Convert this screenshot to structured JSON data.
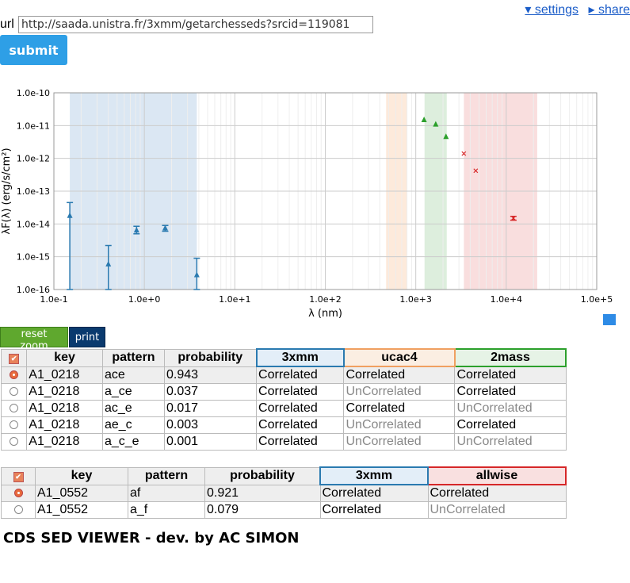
{
  "top_links": {
    "settings": "▾ settings",
    "share": "▸ share"
  },
  "url_label": "url",
  "url_value": "http://saada.unistra.fr/3xmm/getarchesseds?srcid=119081",
  "submit_label": "submit",
  "reset_zoom_label": "reset zoom",
  "print_label": "print",
  "footer": "CDS SED VIEWER - dev. by AC SIMON",
  "chart_data": {
    "type": "scatter",
    "xlabel": "λ (nm)",
    "ylabel": "λF(λ) (erg/s/cm²)",
    "xscale": "log",
    "yscale": "log",
    "xlim": [
      0.1,
      100000
    ],
    "ylim": [
      1e-16,
      1e-10
    ],
    "x_tick_labels": [
      "1.0e-1",
      "1.0e+0",
      "1.0e+1",
      "1.0e+2",
      "1.0e+3",
      "1.0e+4",
      "1.0e+5"
    ],
    "y_tick_labels": [
      "1.0e-10",
      "1.0e-11",
      "1.0e-12",
      "1.0e-13",
      "1.0e-14",
      "1.0e-15",
      "1.0e-16"
    ],
    "bands": [
      {
        "x0": 0.15,
        "x1": 3.8,
        "color": "#dbe7f3"
      },
      {
        "x0": 470,
        "x1": 800,
        "color": "#fdeadb"
      },
      {
        "x0": 1250,
        "x1": 2200,
        "color": "#ddeedd"
      },
      {
        "x0": 3400,
        "x1": 22000,
        "color": "#f9dede"
      }
    ],
    "series": [
      {
        "marker": "triangle",
        "color": "#2a7ab0",
        "points": [
          {
            "x": 0.15,
            "y": 1.8e-14,
            "ylo": 1e-16,
            "yhi": 4.5e-14
          },
          {
            "x": 0.4,
            "y": 6e-16,
            "ylo": 1e-16,
            "yhi": 2.2e-15
          },
          {
            "x": 0.82,
            "y": 6.5e-15,
            "ylo": 5e-15,
            "yhi": 8.5e-15
          },
          {
            "x": 1.7,
            "y": 7.5e-15,
            "ylo": 6e-15,
            "yhi": 9e-15
          },
          {
            "x": 3.8,
            "y": 2.8e-16,
            "ylo": 1e-16,
            "yhi": 9e-16
          }
        ]
      },
      {
        "marker": "triangle",
        "color": "#2ca02c",
        "points": [
          {
            "x": 1235,
            "y": 1.5e-11
          },
          {
            "x": 1662,
            "y": 1.1e-11
          },
          {
            "x": 2159,
            "y": 4.6e-12
          }
        ]
      },
      {
        "marker": "cross",
        "color": "#d62728",
        "points": [
          {
            "x": 3400,
            "y": 1.4e-12
          },
          {
            "x": 4600,
            "y": 4.2e-13
          },
          {
            "x": 12000,
            "y": 1.5e-14,
            "ylo": 1.3e-14,
            "yhi": 1.7e-14
          }
        ]
      }
    ]
  },
  "table1": {
    "headers": [
      "key",
      "pattern",
      "probability",
      "3xmm",
      "ucac4",
      "2mass"
    ],
    "rows": [
      {
        "selected": true,
        "key": "A1_0218",
        "pattern": "ace",
        "probability": "0.943",
        "c1": "Correlated",
        "c2": "Correlated",
        "c3": "Correlated"
      },
      {
        "selected": false,
        "key": "A1_0218",
        "pattern": "a_ce",
        "probability": "0.037",
        "c1": "Correlated",
        "c2": "UnCorrelated",
        "c3": "Correlated"
      },
      {
        "selected": false,
        "key": "A1_0218",
        "pattern": "ac_e",
        "probability": "0.017",
        "c1": "Correlated",
        "c2": "Correlated",
        "c3": "UnCorrelated"
      },
      {
        "selected": false,
        "key": "A1_0218",
        "pattern": "ae_c",
        "probability": "0.003",
        "c1": "Correlated",
        "c2": "UnCorrelated",
        "c3": "Correlated"
      },
      {
        "selected": false,
        "key": "A1_0218",
        "pattern": "a_c_e",
        "probability": "0.001",
        "c1": "Correlated",
        "c2": "UnCorrelated",
        "c3": "UnCorrelated"
      }
    ]
  },
  "table2": {
    "headers": [
      "key",
      "pattern",
      "probability",
      "3xmm",
      "allwise"
    ],
    "rows": [
      {
        "selected": true,
        "key": "A1_0552",
        "pattern": "af",
        "probability": "0.921",
        "c1": "Correlated",
        "c2": "Correlated"
      },
      {
        "selected": false,
        "key": "A1_0552",
        "pattern": "a_f",
        "probability": "0.079",
        "c1": "Correlated",
        "c2": "UnCorrelated"
      }
    ]
  },
  "colors": {
    "cat1": "#2a7ab0",
    "cat2": "#f0a060",
    "cat3": "#2ca02c",
    "cat4": "#d62728"
  }
}
